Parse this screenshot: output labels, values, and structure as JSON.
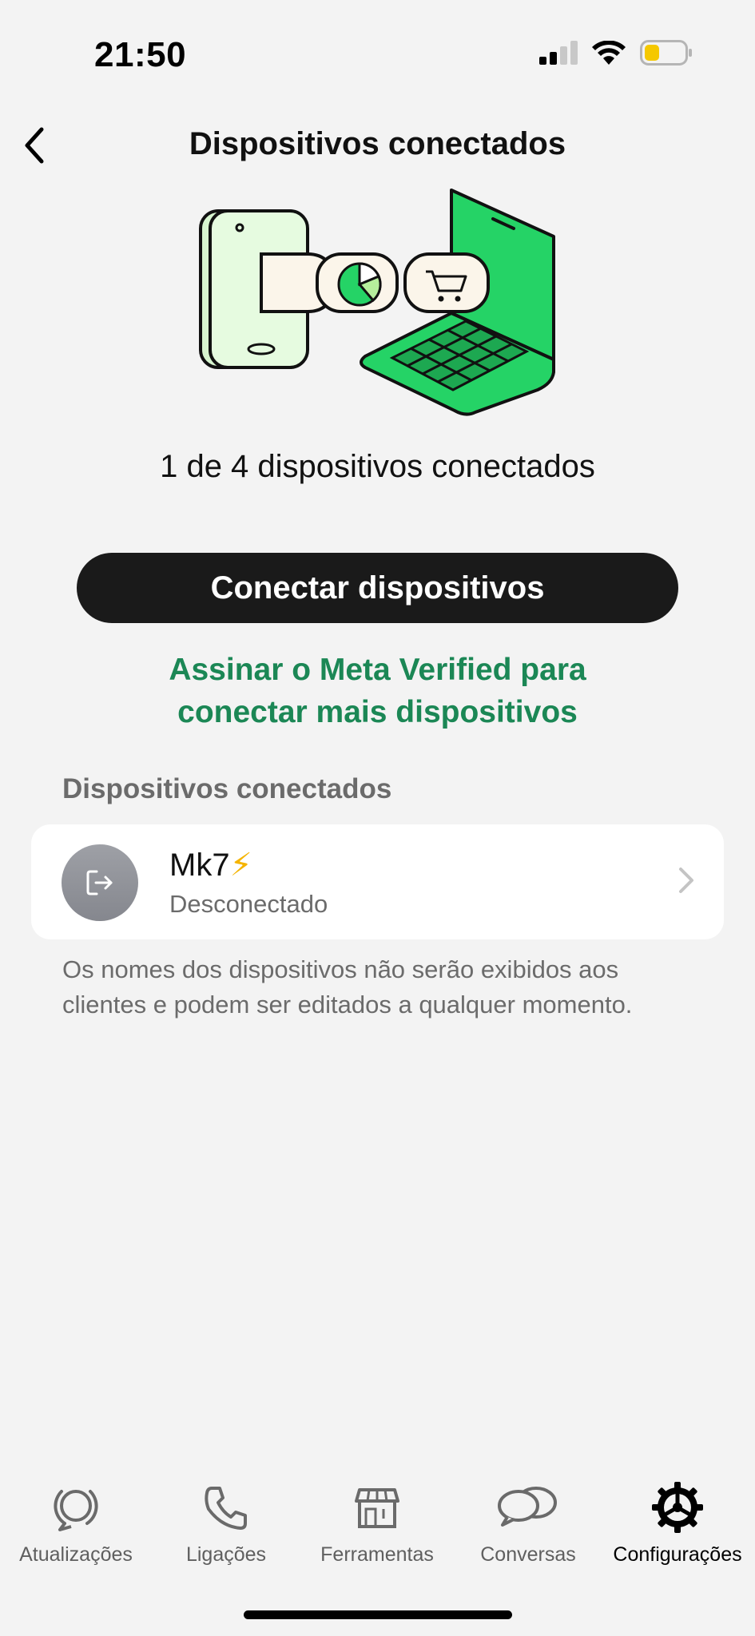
{
  "status_bar": {
    "time": "21:50",
    "icons": [
      "cellular-signal-icon",
      "wifi-icon",
      "battery-icon"
    ],
    "battery_color": "#f5c800"
  },
  "header": {
    "title": "Dispositivos conectados",
    "back_icon": "chevron-left-icon"
  },
  "illustration": {
    "icons": [
      "phone-icon",
      "pie-chart-icon",
      "shopping-cart-icon",
      "laptop-icon"
    ],
    "accent": "#25d366",
    "light_green": "#e6fbe0"
  },
  "summary": {
    "device_count_text": "1 de 4 dispositivos conectados"
  },
  "actions": {
    "connect_label": "Conectar dispositivos",
    "meta_verified_line1": "Assinar o Meta Verified para",
    "meta_verified_line2": "conectar mais dispositivos",
    "link_color": "#1b8755"
  },
  "devices_section": {
    "header": "Dispositivos conectados",
    "devices": [
      {
        "name": "Mk7",
        "emoji": "⚡",
        "status": "Desconectado",
        "icon": "logout-icon"
      }
    ],
    "footnote": "Os nomes dos dispositivos não serão exibidos aos clientes e podem ser editados a qualquer momento."
  },
  "tab_bar": {
    "tabs": [
      {
        "label": "Atualizações",
        "icon": "updates-icon",
        "active": false
      },
      {
        "label": "Ligações",
        "icon": "phone-icon",
        "active": false
      },
      {
        "label": "Ferramentas",
        "icon": "storefront-icon",
        "active": false
      },
      {
        "label": "Conversas",
        "icon": "chats-icon",
        "active": false
      },
      {
        "label": "Configurações",
        "icon": "settings-gear-icon",
        "active": true
      }
    ]
  }
}
